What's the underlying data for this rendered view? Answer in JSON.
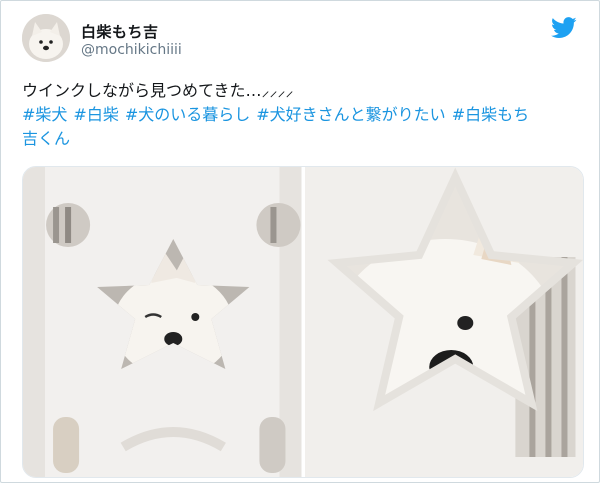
{
  "user": {
    "display_name": "白柴もち吉",
    "handle": "@mochikichiiii",
    "avatar_icon": "shiba-avatar-icon"
  },
  "brand": {
    "icon": "twitter-bird-icon",
    "color": "#1DA1F2"
  },
  "tweet": {
    "text": "ウインクしながら見つめてきた…⸝⸝⸝⸝",
    "hashtags_line1": [
      "#柴犬",
      "#白柴",
      "#犬のいる暮らし",
      "#犬好きさんと繋がりたい",
      "#白柴もち"
    ],
    "hashtags_line2": [
      "吉くん"
    ]
  },
  "media": {
    "photos": [
      {
        "subject": "white shiba winking through star-shaped gate hole"
      },
      {
        "subject": "close-up of white shiba winking through star-shaped gate hole"
      }
    ]
  },
  "colors": {
    "hashtag": "#1B95E0",
    "handle": "#657786",
    "text": "#14171A"
  }
}
